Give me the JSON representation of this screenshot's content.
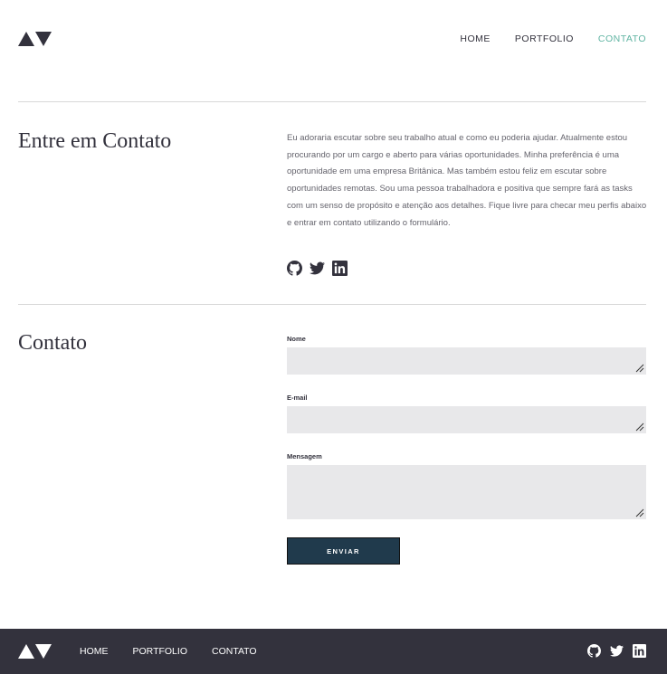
{
  "header": {
    "logo_icon": "av-triangles-logo",
    "nav": [
      {
        "label": "HOME",
        "active": false
      },
      {
        "label": "PORTFOLIO",
        "active": false
      },
      {
        "label": "CONTATO",
        "active": true
      }
    ]
  },
  "intro": {
    "title": "Entre em Contato",
    "text": "Eu adoraria escutar sobre seu trabalho atual e como eu poderia ajudar. Atualmente estou procurando por um cargo e aberto para várias oportunidades. Minha preferência é uma oportunidade em uma empresa Britânica. Mas também estou feliz em escutar sobre oportunidades remotas. Sou uma pessoa trabalhadora e positiva que sempre fará as tasks com um senso de propósito e atenção aos detalhes. Fique livre para checar meu perfis abaixo e entrar em contato utilizando o formulário.",
    "socials": [
      "github-icon",
      "twitter-icon",
      "linkedin-icon"
    ]
  },
  "contact": {
    "title": "Contato",
    "fields": [
      {
        "label": "Nome",
        "value": ""
      },
      {
        "label": "E-mail",
        "value": ""
      },
      {
        "label": "Mensagem",
        "value": ""
      }
    ],
    "submit_label": "ENVIAR"
  },
  "footer": {
    "nav": [
      "HOME",
      "PORTFOLIO",
      "CONTATO"
    ],
    "socials": [
      "github-icon",
      "twitter-icon",
      "linkedin-icon"
    ]
  },
  "colors": {
    "accent": "#5fb4a2",
    "dark": "#33323d",
    "button": "#203a4c",
    "field_bg": "#e8e8ea"
  }
}
